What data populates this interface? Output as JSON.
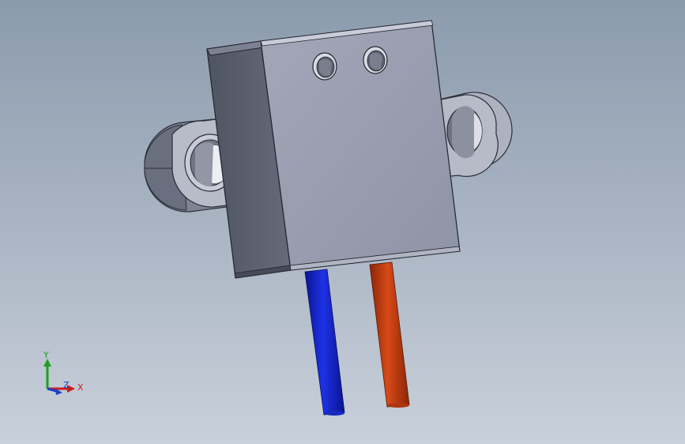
{
  "viewport": {
    "background_top": "#8b9bad",
    "background_bottom": "#c9d0da"
  },
  "model": {
    "body_front_color": "#9ba0b2",
    "body_side_color": "#5a5f6e",
    "body_top_color": "#c7cad6",
    "mount_tab_color": "#a9adbc",
    "wire_left_color": "#1020c8",
    "wire_right_color": "#c83a10"
  },
  "triad": {
    "x_label": "X",
    "y_label": "Y",
    "z_label": "Z",
    "x_color": "#c81e1e",
    "y_color": "#1ea01e",
    "z_color": "#1e3cc8"
  }
}
